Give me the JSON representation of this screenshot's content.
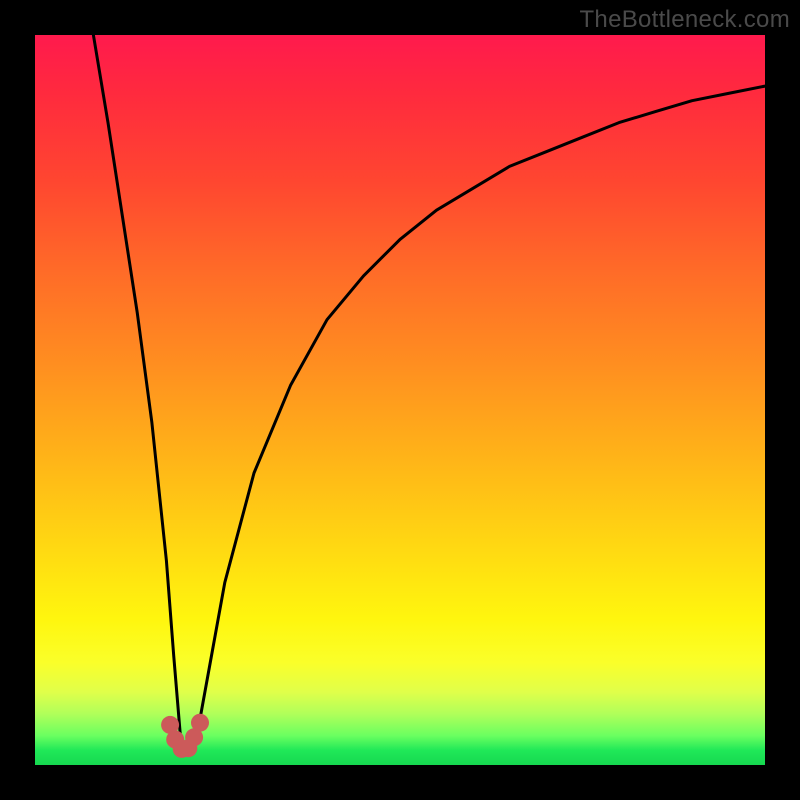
{
  "watermark": "TheBottleneck.com",
  "chart_data": {
    "type": "line",
    "title": "",
    "xlabel": "",
    "ylabel": "",
    "xlim": [
      0,
      100
    ],
    "ylim": [
      0,
      100
    ],
    "grid": false,
    "legend": "none",
    "note": "V-shaped bottleneck curve. Axes have no tick labels; values are estimated from pixel position.",
    "series": [
      {
        "name": "bottleneck-curve",
        "x": [
          8,
          10,
          12,
          14,
          16,
          18,
          19,
          20,
          21,
          22,
          24,
          26,
          30,
          35,
          40,
          45,
          50,
          55,
          60,
          65,
          70,
          75,
          80,
          85,
          90,
          95,
          100
        ],
        "y": [
          100,
          88,
          75,
          62,
          47,
          28,
          15,
          3,
          2,
          3,
          14,
          25,
          40,
          52,
          61,
          67,
          72,
          76,
          79,
          82,
          84,
          86,
          88,
          89.5,
          91,
          92,
          93
        ]
      }
    ],
    "minimum": {
      "x": 20.5,
      "y": 2
    },
    "markers": {
      "name": "minimum-cluster",
      "color": "#cc5a5a",
      "points_x": [
        18.5,
        19.2,
        20.1,
        21.0,
        21.8,
        22.6
      ],
      "points_y": [
        5.5,
        3.5,
        2.2,
        2.3,
        3.8,
        5.8
      ]
    }
  },
  "colors": {
    "curve": "#000000",
    "marker": "#cc5a5a",
    "frame": "#000000"
  }
}
